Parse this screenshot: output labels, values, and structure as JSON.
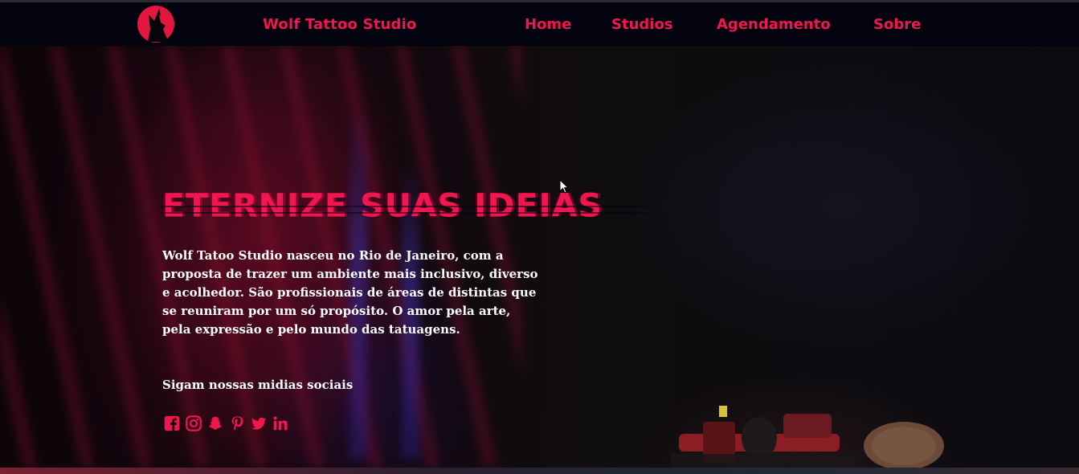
{
  "colors": {
    "accent": "#f0164f",
    "navbar_bg": "#03030f",
    "text": "#ffffff"
  },
  "navbar": {
    "logo_icon": "wolf-head-logo",
    "brand": "Wolf Tattoo Studio",
    "links": [
      {
        "label": "Home"
      },
      {
        "label": "Studios"
      },
      {
        "label": "Agendamento"
      },
      {
        "label": "Sobre"
      }
    ]
  },
  "hero": {
    "headline": "ETERNIZE SUAS IDEIAS",
    "description": "Wolf Tatoo Studio nasceu no Rio de Janeiro, com a proposta de trazer um ambiente mais inclusivo, diverso e acolhedor. São profissionais de áreas de distintas que se reuniram por um só propósito. O amor pela arte, pela expressão e pelo mundo das tatuagens.",
    "social_title": "Sigam nossas midias sociais",
    "social_icons": [
      "facebook-icon",
      "instagram-icon",
      "snapchat-icon",
      "pinterest-icon",
      "twitter-icon",
      "linkedin-icon"
    ]
  }
}
